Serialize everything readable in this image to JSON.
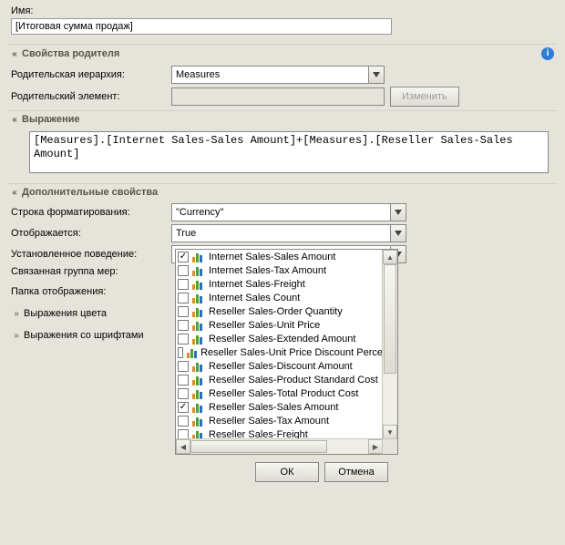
{
  "name_field": {
    "label": "Имя:",
    "value": "[Итоговая сумма продаж]"
  },
  "sections": {
    "parent": {
      "title": "Свойства родителя",
      "hierarchy_label": "Родительская иерархия:",
      "hierarchy_value": "Measures",
      "element_label": "Родительский элемент:",
      "element_value": "",
      "change_btn": "Изменить"
    },
    "expression": {
      "title": "Выражение",
      "value": "[Measures].[Internet Sales-Sales Amount]+[Measures].[Reseller Sales-Sales Amount]"
    },
    "additional": {
      "title": "Дополнительные свойства",
      "format_label": "Строка форматирования:",
      "format_value": "\"Currency\"",
      "visible_label": "Отображается:",
      "visible_value": "True",
      "behavior_label": "Установленное поведение:",
      "behavior_value": "",
      "measure_group_label": "Связанная группа мер:",
      "display_folder_label": "Папка отображения:",
      "color_expr_label": "Выражения цвета",
      "font_expr_label": "Выражения со шрифтами"
    }
  },
  "behavior_list": [
    {
      "label": "Internet Sales-Sales Amount",
      "checked": true
    },
    {
      "label": "Internet Sales-Tax Amount",
      "checked": false
    },
    {
      "label": "Internet Sales-Freight",
      "checked": false
    },
    {
      "label": "Internet Sales Count",
      "checked": false
    },
    {
      "label": "Reseller Sales-Order Quantity",
      "checked": false
    },
    {
      "label": "Reseller Sales-Unit Price",
      "checked": false
    },
    {
      "label": "Reseller Sales-Extended Amount",
      "checked": false
    },
    {
      "label": "Reseller Sales-Unit Price Discount Perce",
      "checked": false
    },
    {
      "label": "Reseller Sales-Discount Amount",
      "checked": false
    },
    {
      "label": "Reseller Sales-Product Standard Cost",
      "checked": false
    },
    {
      "label": "Reseller Sales-Total Product Cost",
      "checked": false
    },
    {
      "label": "Reseller Sales-Sales Amount",
      "checked": true
    },
    {
      "label": "Reseller Sales-Tax Amount",
      "checked": false
    },
    {
      "label": "Reseller Sales-Freight",
      "checked": false
    }
  ],
  "buttons": {
    "ok": "ОК",
    "cancel": "Отмена"
  }
}
